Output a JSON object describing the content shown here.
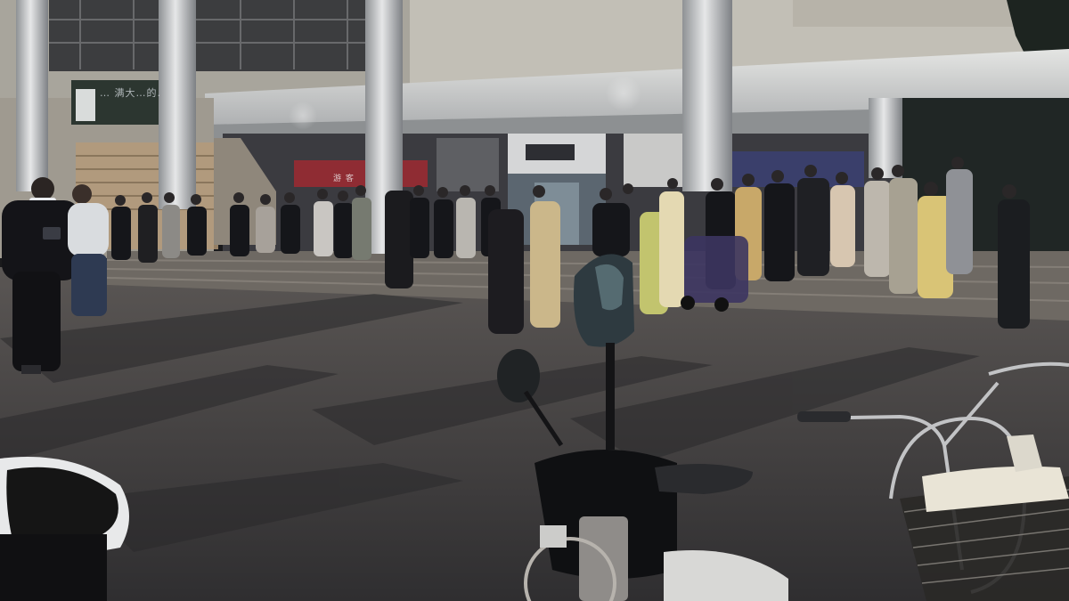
{
  "scene": {
    "description_kind": "night-time photograph, crowd gathered on plaza in front of a building",
    "colors": {
      "sky_dark": "#1a1a1c",
      "building_wall": "#b9b6ae",
      "canopy": "#d6d8d9",
      "pillar": "#c9cbcc",
      "plaza": "#4a4848",
      "steps": "#6e6963",
      "red_sign": "#8f2c33",
      "blue_panel": "#3a3f6b"
    }
  },
  "signage": {
    "banner_left": "… 满大…的…争是…",
    "red_sign": "游 客"
  },
  "people_count_estimate": 60
}
